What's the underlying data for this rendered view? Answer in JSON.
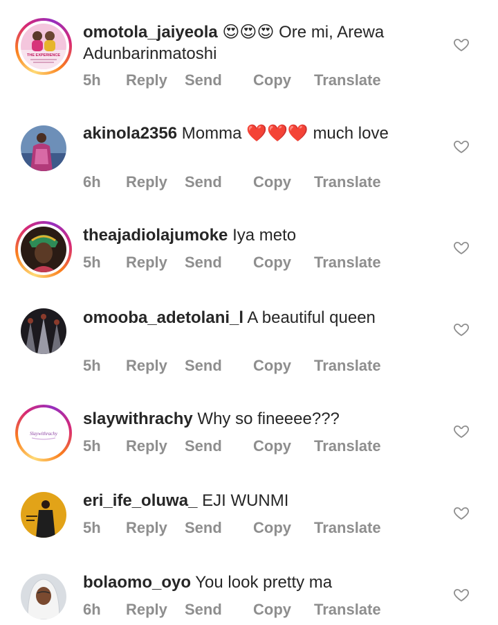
{
  "actions": {
    "reply": "Reply",
    "send": "Send",
    "copy": "Copy",
    "translate": "Translate"
  },
  "comments": [
    {
      "username": "omotola_jaiyeola",
      "emoji": "😍😍😍",
      "text": "Ore mi, Arewa Adunbarinmatoshi",
      "time": "5h",
      "avatar_text": "THE EXPERIENCE"
    },
    {
      "username": "akinola2356",
      "text_before": "Momma",
      "emoji": "❤️❤️❤️",
      "text": "much love",
      "time": "6h"
    },
    {
      "username": "theajadiolajumoke",
      "text": "Iya meto",
      "time": "5h"
    },
    {
      "username": "omooba_adetolani_l",
      "text": "A beautiful queen",
      "time": "5h"
    },
    {
      "username": "slaywithrachy",
      "text": "Why so fineeee???",
      "time": "5h",
      "avatar_text": "Slaywithrachy"
    },
    {
      "username": "eri_ife_oluwa_",
      "text": "EJI WUNMI",
      "time": "5h"
    },
    {
      "username": "bolaomo_oyo",
      "text": "You look pretty ma",
      "time": "6h"
    }
  ],
  "icons": {
    "like": "heart-outline-icon"
  },
  "colors": {
    "text": "#262626",
    "muted": "#8e8e8e",
    "story_ring": [
      "#feda75",
      "#fa7e1e",
      "#d62976",
      "#962fbf"
    ]
  }
}
